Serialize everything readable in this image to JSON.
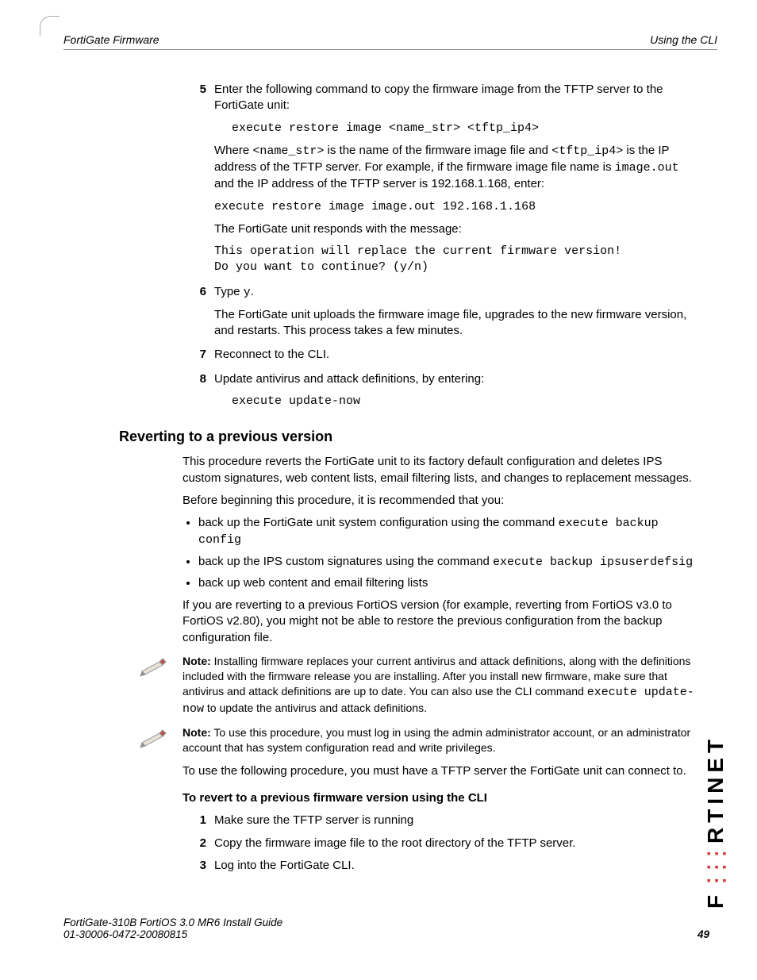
{
  "header": {
    "left": "FortiGate Firmware",
    "right": "Using the CLI"
  },
  "steps_a": {
    "s5_num": "5",
    "s5_text": "Enter the following command to copy the firmware image from the TFTP server to the FortiGate unit:",
    "s5_cmd": "execute restore image <name_str> <tftp_ip4>",
    "s5_w1": "Where ",
    "s5_c1": "<name_str>",
    "s5_w2": " is the name of the firmware image file and ",
    "s5_c2": "<tftp_ip4>",
    "s5_w3": " is the IP address of the TFTP server. For example, if the firmware image file name is ",
    "s5_c3": "image.out",
    "s5_w4": " and the IP address of the TFTP server is 192.168.1.168, enter:",
    "s5_cmd2": "execute restore image image.out 192.168.1.168",
    "s5_resp_label": "The FortiGate unit responds with the message:",
    "s5_resp": "This operation will replace the current firmware version!\nDo you want to continue? (y/n)",
    "s6_num": "6",
    "s6_a": "Type ",
    "s6_code": "y",
    "s6_b": ".",
    "s6_post": "The FortiGate unit uploads the firmware image file, upgrades to the new firmware version, and restarts. This process takes a few minutes.",
    "s7_num": "7",
    "s7_text": "Reconnect to the CLI.",
    "s8_num": "8",
    "s8_text": "Update antivirus and attack definitions, by entering:",
    "s8_cmd": "execute update-now"
  },
  "section_title": "Reverting to a previous version",
  "revert": {
    "p1": "This procedure reverts the FortiGate unit to its factory default configuration and deletes IPS custom signatures, web content lists, email filtering lists, and changes to replacement messages.",
    "p2": "Before beginning this procedure, it is recommended that you:",
    "b1a": "back up the FortiGate unit system configuration using the command ",
    "b1c": "execute backup config",
    "b2a": "back up the IPS custom signatures using the command ",
    "b2c": "execute backup ipsuserdefsig",
    "b3": "back up web content and email filtering lists",
    "p3": "If you are reverting to a previous FortiOS version (for example, reverting from FortiOS v3.0 to FortiOS v2.80), you might not be able to restore the previous configuration from the backup configuration file.",
    "note1_b": "Note:",
    "note1_a": " Installing firmware replaces your current antivirus and attack definitions, along with the definitions included with the firmware release you are installing. After you install new firmware, make sure that antivirus and attack definitions are up to date. You can also use the CLI command ",
    "note1_c": "execute update-now",
    "note1_d": " to update the antivirus and attack definitions.",
    "note2_b": "Note:",
    "note2_t": " To use this procedure, you must log in using the admin administrator account, or an administrator account that has system configuration read and write privileges.",
    "p4": "To use the following procedure, you must have a TFTP server the FortiGate unit can connect to.",
    "sub": "To revert to a previous firmware version using the CLI",
    "r1n": "1",
    "r1": "Make sure the TFTP server is running",
    "r2n": "2",
    "r2": "Copy the firmware image file to the root directory of the TFTP server.",
    "r3n": "3",
    "r3": "Log into the FortiGate CLI."
  },
  "footer": {
    "l1": "FortiGate-310B FortiOS 3.0 MR6 Install Guide",
    "l2": "01-30006-0472-20080815",
    "page": "49"
  },
  "logo": {
    "a": "F",
    "b": "RTINET"
  }
}
